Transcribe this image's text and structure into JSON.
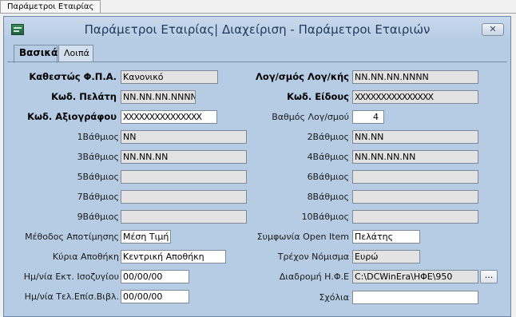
{
  "doc_tab": "Παράμετροι Εταιρίας",
  "window": {
    "title": "Παράμετροι Εταιρίας| Διαχείριση - Παράμετροι Εταιριών",
    "close_label": "✕"
  },
  "tabs": [
    {
      "label": "Βασικά"
    },
    {
      "label": "Λοιπά"
    }
  ],
  "left": {
    "vat_status": {
      "label": "Καθεστώς Φ.Π.Α.",
      "value": "Κανονικό"
    },
    "customer_code": {
      "label": "Κωδ. Πελάτη",
      "value": "NN.NN.NN.NNNN"
    },
    "security_code": {
      "label": "Κωδ. Αξιογράφου",
      "value": "XXXXXXXXXXXXXXX"
    },
    "level1": {
      "label": "1Βάθμιος",
      "value": "NN"
    },
    "level3": {
      "label": "3Βάθμιος",
      "value": "NN.NN.NN"
    },
    "level5": {
      "label": "5Βάθμιος",
      "value": ""
    },
    "level7": {
      "label": "7Βάθμιος",
      "value": ""
    },
    "level9": {
      "label": "9Βάθμιος",
      "value": ""
    },
    "valuation_method": {
      "label": "Μέθοδος Αποτίμησης",
      "value": "Μέση Τιμή"
    },
    "main_warehouse": {
      "label": "Κύρια Αποθήκη",
      "value": "Κεντρική Αποθήκη"
    },
    "balance_date": {
      "label": "Ημ/νία Εκτ. Ισοζυγίου",
      "value": "00/00/00"
    },
    "final_date": {
      "label": "Ημ/νία Τελ.Επίσ.Βιβλ.",
      "value": "00/00/00"
    }
  },
  "right": {
    "account_code": {
      "label": "Λογ/σμός Λογ/κής",
      "value": "NN.NN.NN.NNNN"
    },
    "item_code": {
      "label": "Κωδ. Είδους",
      "value": "XXXXXXXXXXXXXXX"
    },
    "account_level": {
      "label": "Βαθμός Λογ/σμού",
      "value": "4"
    },
    "level2": {
      "label": "2Βάθμιος",
      "value": "NN.NN"
    },
    "level4": {
      "label": "4Βάθμιος",
      "value": "NN.NN.NN.NN"
    },
    "level6": {
      "label": "6Βάθμιος",
      "value": ""
    },
    "level8": {
      "label": "8Βάθμιος",
      "value": ""
    },
    "level10": {
      "label": "10Βάθμιος",
      "value": ""
    },
    "open_item": {
      "label": "Συμφωνία Open Item",
      "value": "Πελάτης"
    },
    "currency": {
      "label": "Τρέχον Νόμισμα",
      "value": "Ευρώ"
    },
    "path": {
      "label": "Διαδρομή Η.Φ.Ε",
      "value": "C:\\DCWinEra\\ΗΦΕ\\950",
      "button": "..."
    },
    "comments": {
      "label": "Σχόλια",
      "value": ""
    }
  }
}
